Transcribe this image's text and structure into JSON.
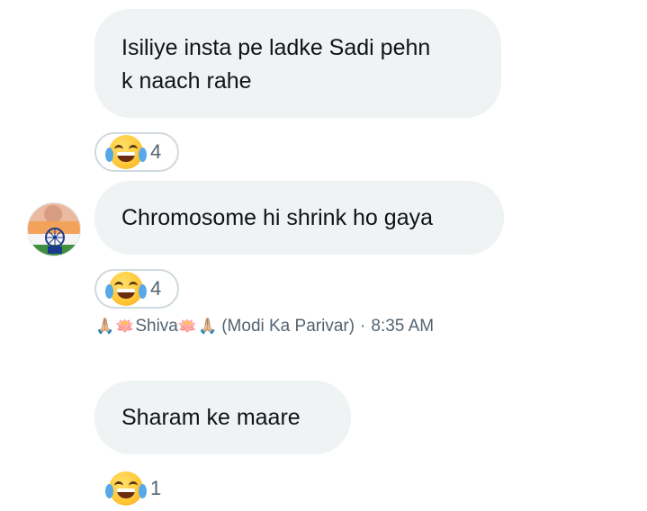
{
  "messages": [
    {
      "text_line1": "Isiliye insta pe ladke Sadi pehn",
      "text_line2": "k naach rahe",
      "reaction": {
        "emoji": "face-with-tears-of-joy",
        "count": "4"
      }
    },
    {
      "text": "Chromosome hi shrink ho gaya",
      "reaction": {
        "emoji": "face-with-tears-of-joy",
        "count": "4"
      }
    },
    {
      "text": "Sharam ke maare",
      "reaction": {
        "emoji": "face-with-tears-of-joy",
        "count": "1"
      }
    }
  ],
  "meta": {
    "prayer_emoji": "🙏🏼",
    "lotus_emoji": "🪷",
    "name": "Shiva",
    "affiliation": "(Modi Ka Parivar)",
    "separator": "·",
    "time": "8:35 AM"
  },
  "colors": {
    "bubble_bg": "#eff3f4",
    "text": "#0f1419",
    "secondary_text": "#536471",
    "reaction_border": "#cfd9de"
  }
}
